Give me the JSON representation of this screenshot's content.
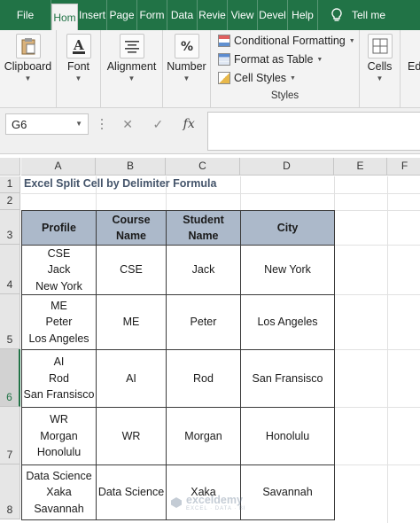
{
  "tabs": [
    {
      "label": "File",
      "active": false
    },
    {
      "label": "Hom",
      "active": true
    },
    {
      "label": "Insert",
      "active": false
    },
    {
      "label": "Page",
      "active": false
    },
    {
      "label": "Form",
      "active": false
    },
    {
      "label": "Data",
      "active": false
    },
    {
      "label": "Revie",
      "active": false
    },
    {
      "label": "View",
      "active": false
    },
    {
      "label": "Devel",
      "active": false
    },
    {
      "label": "Help",
      "active": false
    }
  ],
  "tell_me": "Tell me",
  "ribbon": {
    "clipboard": "Clipboard",
    "font": "Font",
    "alignment": "Alignment",
    "number": "Number",
    "styles": {
      "conditional": "Conditional Formatting",
      "format_table": "Format as Table",
      "cell_styles": "Cell Styles",
      "label": "Styles"
    },
    "cells": "Cells",
    "editing": "Ed"
  },
  "formula_bar": {
    "name_box": "G6",
    "cancel": "✕",
    "enter": "✓",
    "fx": "fx",
    "content": ""
  },
  "columns": [
    "A",
    "B",
    "C",
    "D",
    "E",
    "F"
  ],
  "rows": [
    "1",
    "2",
    "3",
    "4",
    "5",
    "6",
    "7",
    "8"
  ],
  "sheet": {
    "title": "Excel Split Cell by Delimiter Formula",
    "headers": [
      "Profile",
      "Course Name",
      "Student Name",
      "City"
    ],
    "records": [
      {
        "profile": [
          "CSE",
          "Jack",
          "New York"
        ],
        "course": "CSE",
        "student": "Jack",
        "city": "New York"
      },
      {
        "profile": [
          "ME",
          "Peter",
          "Los Angeles"
        ],
        "course": "ME",
        "student": "Peter",
        "city": "Los Angeles"
      },
      {
        "profile": [
          "AI",
          "Rod",
          "San Fransisco"
        ],
        "course": "AI",
        "student": "Rod",
        "city": "San Fransisco"
      },
      {
        "profile": [
          "WR",
          "Morgan",
          "Honolulu"
        ],
        "course": "WR",
        "student": "Morgan",
        "city": "Honolulu"
      },
      {
        "profile": [
          "Data Science",
          "Xaka",
          "Savannah"
        ],
        "course": "Data Science",
        "student": "Xaka",
        "city": "Savannah"
      }
    ]
  },
  "selected_cell": "G6",
  "selected_row": "6",
  "watermark": {
    "name": "exceldemy",
    "tagline": "EXCEL · DATA · BI"
  },
  "colors": {
    "accent": "#217346",
    "header_fill": "#acb9ca",
    "title_text": "#44546a"
  }
}
